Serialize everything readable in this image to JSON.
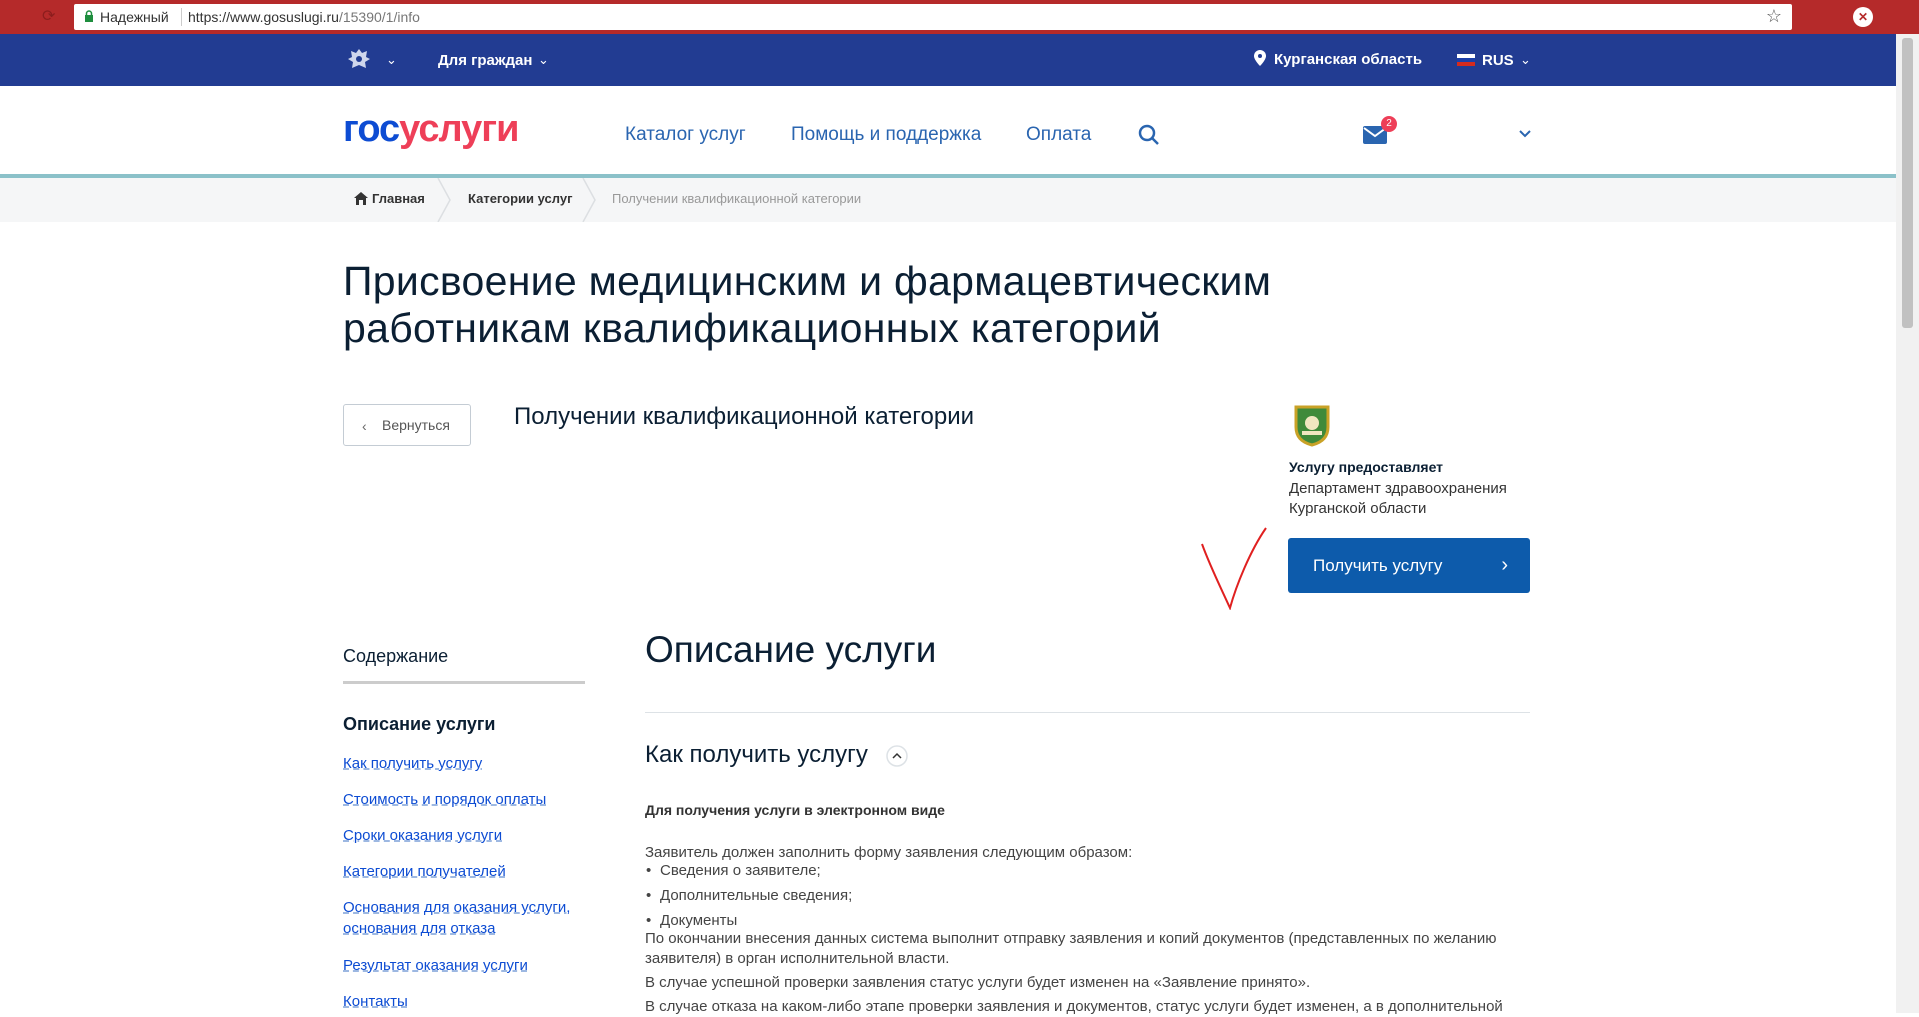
{
  "browser": {
    "secure_label": "Надежный",
    "url_host": "https://www.gosuslugi.ru",
    "url_path": "/15390/1/info"
  },
  "topbar": {
    "for_citizens": "Для граждан",
    "region": "Курганская область",
    "language": "RUS"
  },
  "header": {
    "logo_part1": "гос",
    "logo_part2": "услуги",
    "nav": [
      "Каталог услуг",
      "Помощь и поддержка",
      "Оплата"
    ],
    "mail_count": "2"
  },
  "breadcrumb": [
    "Главная",
    "Категории услуг",
    "Получении квалификационной категории"
  ],
  "page": {
    "title": "Присвоение медицинским и фармацевтическим работникам квалификационных категорий",
    "back_label": "Вернуться",
    "service_name": "Получении квалификационной категории",
    "provider_title": "Услугу предоставляет",
    "provider_name": "Департамент здравоохранения Курганской области",
    "get_service_label": "Получить услугу"
  },
  "toc": {
    "title": "Содержание",
    "active": "Описание услуги",
    "links": [
      "Как получить услугу",
      "Стоимость и порядок оплаты",
      "Сроки оказания услуги",
      "Категории получателей",
      "Основания для оказания услуги, основания для отказа",
      "Результат оказания услуги",
      "Контакты"
    ]
  },
  "content": {
    "desc_title": "Описание услуги",
    "how_title": "Как получить услугу",
    "electronic_title": "Для получения услуги в электронном виде",
    "intro": "Заявитель должен заполнить форму заявления следующим образом:",
    "bullets": [
      "Сведения о заявителе;",
      "Дополнительные сведения;",
      "Документы"
    ],
    "para1": "По окончании внесения данных система выполнит отправку заявления и копий документов (представленных по желанию заявителя) в орган исполнительной власти.",
    "para2": "В случае успешной проверки заявления статус услуги будет изменен на «Заявление принято».",
    "para3": "В случае отказа на каком-либо этапе проверки заявления и документов, статус услуги будет изменен, а в дополнительной"
  },
  "colors": {
    "topbar": "#223c92",
    "logo_blue": "#0d4cd3",
    "logo_red": "#ee3f58",
    "button": "#0d5bab",
    "browser_frame": "#b52a2a"
  }
}
